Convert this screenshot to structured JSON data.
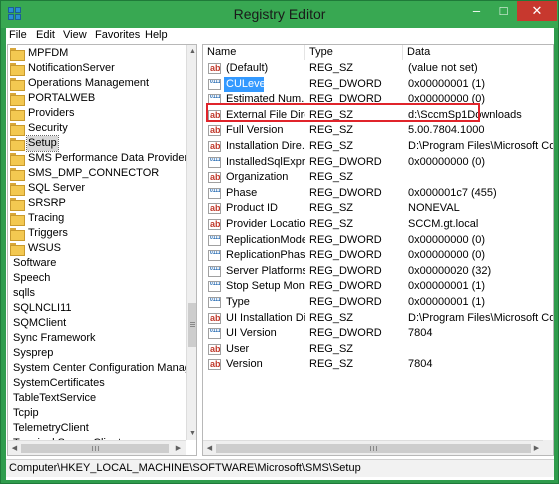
{
  "window": {
    "title": "Registry Editor",
    "controls": {
      "minimize": "–",
      "maximize": "□",
      "close": "✕"
    },
    "titlebar_color": "#38a852",
    "close_color": "#c7382e"
  },
  "menu": [
    "File",
    "Edit",
    "View",
    "Favorites",
    "Help"
  ],
  "tree": {
    "items": [
      {
        "label": "MPFDM",
        "folder": true,
        "indent": 1
      },
      {
        "label": "NotificationServer",
        "folder": true,
        "indent": 1
      },
      {
        "label": "Operations Management",
        "folder": true,
        "indent": 1
      },
      {
        "label": "PORTALWEB",
        "folder": true,
        "indent": 1
      },
      {
        "label": "Providers",
        "folder": true,
        "indent": 1
      },
      {
        "label": "Security",
        "folder": true,
        "indent": 1
      },
      {
        "label": "Setup",
        "folder": true,
        "indent": 1,
        "selected": true
      },
      {
        "label": "SMS Performance Data Provider",
        "folder": true,
        "indent": 1
      },
      {
        "label": "SMS_DMP_CONNECTOR",
        "folder": true,
        "indent": 1
      },
      {
        "label": "SQL Server",
        "folder": true,
        "indent": 1
      },
      {
        "label": "SRSRP",
        "folder": true,
        "indent": 1
      },
      {
        "label": "Tracing",
        "folder": true,
        "indent": 1
      },
      {
        "label": "Triggers",
        "folder": true,
        "indent": 1
      },
      {
        "label": "WSUS",
        "folder": true,
        "indent": 1
      },
      {
        "label": "Software",
        "folder": false,
        "indent": 0
      },
      {
        "label": "Speech",
        "folder": false,
        "indent": 0
      },
      {
        "label": "sqlls",
        "folder": false,
        "indent": 0
      },
      {
        "label": "SQLNCLI11",
        "folder": false,
        "indent": 0
      },
      {
        "label": "SQMClient",
        "folder": false,
        "indent": 0
      },
      {
        "label": "Sync Framework",
        "folder": false,
        "indent": 0
      },
      {
        "label": "Sysprep",
        "folder": false,
        "indent": 0
      },
      {
        "label": "System Center Configuration Manager",
        "folder": false,
        "indent": 0
      },
      {
        "label": "SystemCertificates",
        "folder": false,
        "indent": 0
      },
      {
        "label": "TableTextService",
        "folder": false,
        "indent": 0
      },
      {
        "label": "Tcpip",
        "folder": false,
        "indent": 0
      },
      {
        "label": "TelemetryClient",
        "folder": false,
        "indent": 0
      },
      {
        "label": "Terminal Server Client",
        "folder": false,
        "indent": 0
      }
    ]
  },
  "columns": {
    "name": "Name",
    "type": "Type",
    "data": "Data"
  },
  "values": [
    {
      "name": "(Default)",
      "type": "REG_SZ",
      "data": "(value not set)",
      "icon": "string-value-icon"
    },
    {
      "name": "CULevel",
      "type": "REG_DWORD",
      "data": "0x00000001 (1)",
      "icon": "dword-value-icon",
      "selected": true
    },
    {
      "name": "Estimated Num...",
      "type": "REG_DWORD",
      "data": "0x00000000 (0)",
      "icon": "dword-value-icon"
    },
    {
      "name": "External File Dire...",
      "type": "REG_SZ",
      "data": "d:\\SccmSp1Downloads",
      "icon": "string-value-icon"
    },
    {
      "name": "Full Version",
      "type": "REG_SZ",
      "data": "5.00.7804.1000",
      "icon": "string-value-icon"
    },
    {
      "name": "Installation Dire...",
      "type": "REG_SZ",
      "data": "D:\\Program Files\\Microsoft Con",
      "icon": "string-value-icon"
    },
    {
      "name": "InstalledSqlExpr...",
      "type": "REG_DWORD",
      "data": "0x00000000 (0)",
      "icon": "dword-value-icon"
    },
    {
      "name": "Organization",
      "type": "REG_SZ",
      "data": "",
      "icon": "string-value-icon"
    },
    {
      "name": "Phase",
      "type": "REG_DWORD",
      "data": "0x000001c7 (455)",
      "icon": "dword-value-icon"
    },
    {
      "name": "Product ID",
      "type": "REG_SZ",
      "data": "NONEVAL",
      "icon": "string-value-icon"
    },
    {
      "name": "Provider Location",
      "type": "REG_SZ",
      "data": "SCCM.gt.local",
      "icon": "string-value-icon"
    },
    {
      "name": "ReplicationMode",
      "type": "REG_DWORD",
      "data": "0x00000000 (0)",
      "icon": "dword-value-icon"
    },
    {
      "name": "ReplicationPhase",
      "type": "REG_DWORD",
      "data": "0x00000000 (0)",
      "icon": "dword-value-icon"
    },
    {
      "name": "Server Platforms",
      "type": "REG_DWORD",
      "data": "0x00000020 (32)",
      "icon": "dword-value-icon"
    },
    {
      "name": "Stop Setup Mon...",
      "type": "REG_DWORD",
      "data": "0x00000001 (1)",
      "icon": "dword-value-icon"
    },
    {
      "name": "Type",
      "type": "REG_DWORD",
      "data": "0x00000001 (1)",
      "icon": "dword-value-icon"
    },
    {
      "name": "UI Installation Di...",
      "type": "REG_SZ",
      "data": "D:\\Program Files\\Microsoft Con",
      "icon": "string-value-icon"
    },
    {
      "name": "UI Version",
      "type": "REG_DWORD",
      "data": "7804",
      "icon": "dword-value-icon"
    },
    {
      "name": "User",
      "type": "REG_SZ",
      "data": "",
      "icon": "string-value-icon"
    },
    {
      "name": "Version",
      "type": "REG_SZ",
      "data": "7804",
      "icon": "string-value-icon"
    }
  ],
  "status": "Computer\\HKEY_LOCAL_MACHINE\\SOFTWARE\\Microsoft\\SMS\\Setup",
  "highlight_color": "#e0242b",
  "selection_color": "#3399ff"
}
